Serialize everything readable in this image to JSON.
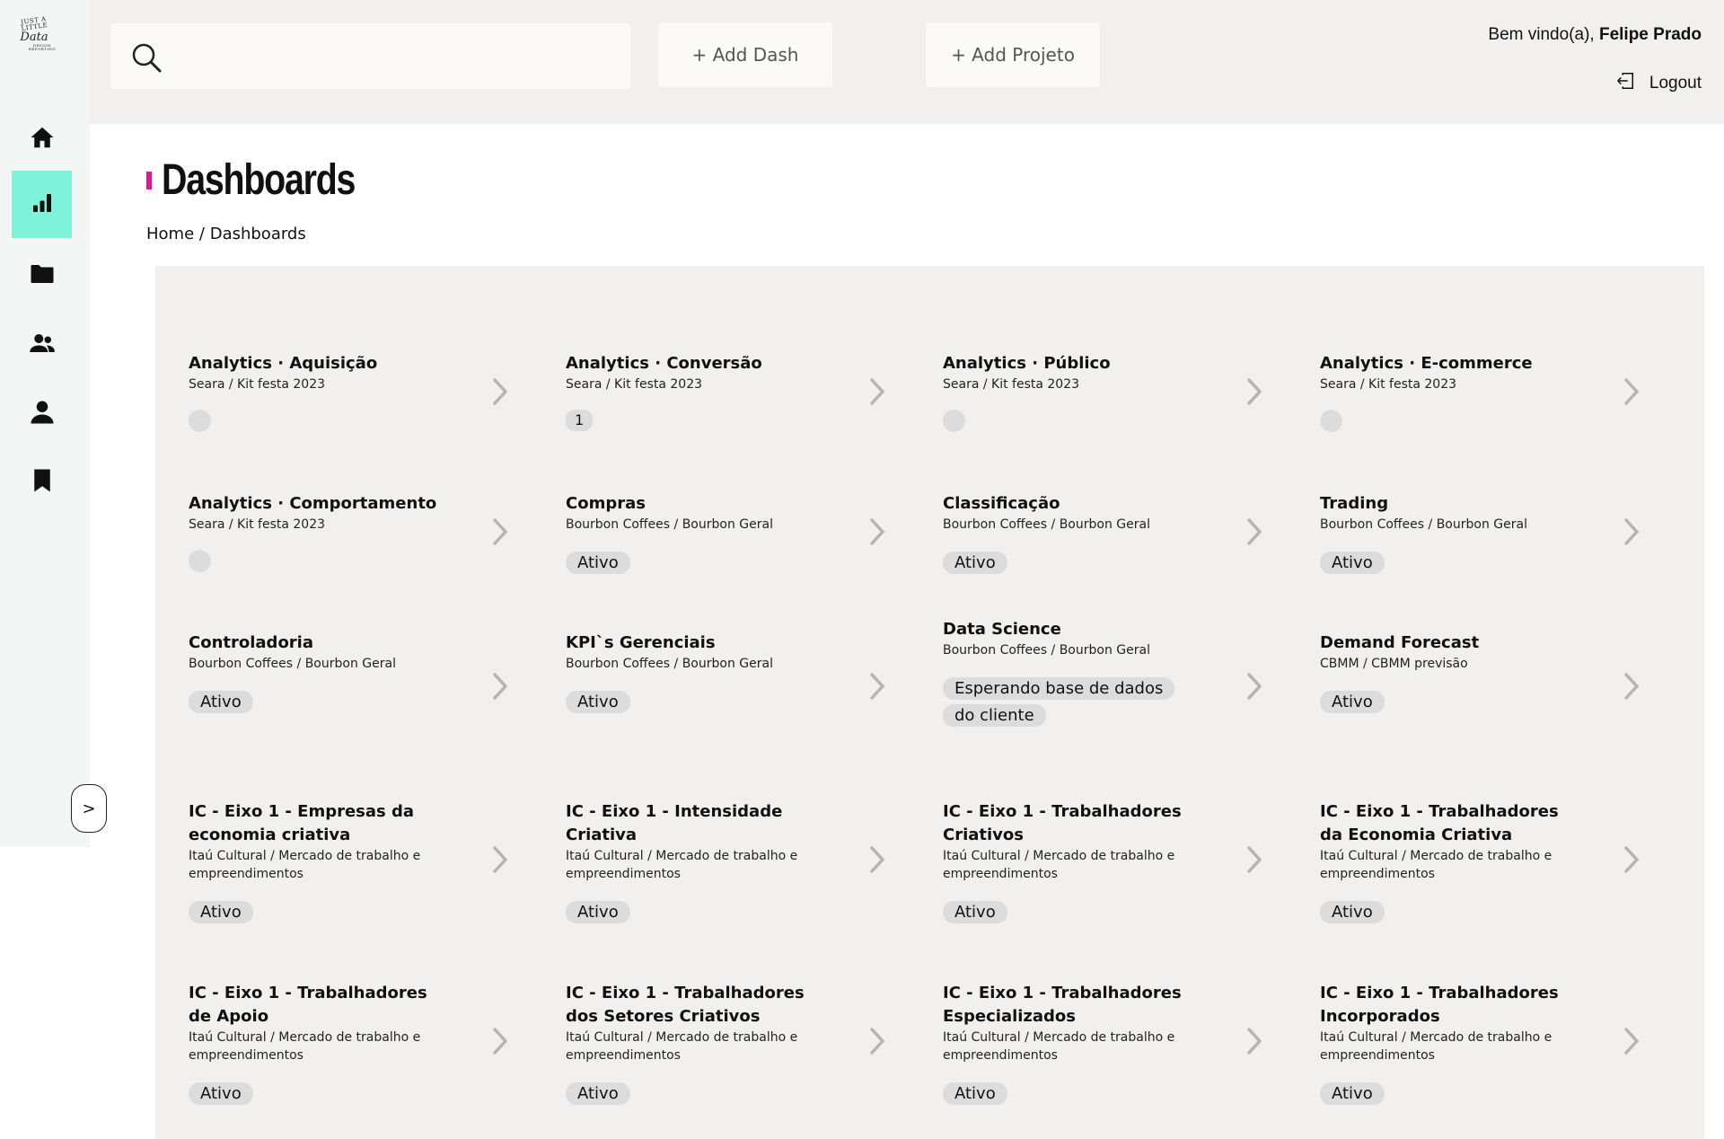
{
  "logo": {
    "line1": "JUST A LITTLE",
    "line2": "Data",
    "line3": "DESIGN REPORTING"
  },
  "sidebar": {
    "items": [
      {
        "name": "home-icon",
        "label": "Home"
      },
      {
        "name": "chart-icon",
        "label": "Dashboards",
        "active": true
      },
      {
        "name": "folder-icon",
        "label": "Projetos"
      },
      {
        "name": "group-icon",
        "label": "Clientes"
      },
      {
        "name": "user-icon",
        "label": "Usuários"
      },
      {
        "name": "bookmark-icon",
        "label": "Favoritos"
      }
    ],
    "toggle_label": ">"
  },
  "topbar": {
    "search_placeholder": "",
    "add_dash_label": "+ Add Dash",
    "add_project_label": "+ Add Projeto",
    "welcome_prefix": "Bem vindo(a), ",
    "user_name": "Felipe Prado",
    "logout_label": "Logout"
  },
  "page": {
    "title": "Dashboards",
    "breadcrumb_home": "Home",
    "breadcrumb_sep": "/",
    "breadcrumb_current": "Dashboards"
  },
  "colors": {
    "accent_active": "#7ff3da",
    "title_marker": "#e6158f",
    "panel_bg": "#f1f0ee",
    "badge_bg": "#dcdcdc"
  },
  "dashboards": [
    {
      "title": "Analytics · Aquisição",
      "subtitle": "Seara / Kit festa 2023",
      "status": ""
    },
    {
      "title": "Analytics · Conversão",
      "subtitle": "Seara / Kit festa 2023",
      "status": "1"
    },
    {
      "title": "Analytics · Público",
      "subtitle": "Seara / Kit festa 2023",
      "status": ""
    },
    {
      "title": "Analytics · E-commerce",
      "subtitle": "Seara / Kit festa 2023",
      "status": ""
    },
    {
      "title": "Analytics · Comportamento",
      "subtitle": "Seara / Kit festa 2023",
      "status": ""
    },
    {
      "title": "Compras",
      "subtitle": "Bourbon Coffees / Bourbon Geral",
      "status": "Ativo"
    },
    {
      "title": "Classificação",
      "subtitle": "Bourbon Coffees / Bourbon Geral",
      "status": "Ativo"
    },
    {
      "title": "Trading",
      "subtitle": "Bourbon Coffees / Bourbon Geral",
      "status": "Ativo"
    },
    {
      "title": "Controladoria",
      "subtitle": "Bourbon Coffees / Bourbon Geral",
      "status": "Ativo"
    },
    {
      "title": "KPI`s Gerenciais",
      "subtitle": "Bourbon Coffees / Bourbon Geral",
      "status": "Ativo"
    },
    {
      "title": "Data Science",
      "subtitle": "Bourbon Coffees / Bourbon Geral",
      "status": "Esperando base de dados do cliente"
    },
    {
      "title": "Demand Forecast",
      "subtitle": "CBMM / CBMM previsão",
      "status": "Ativo"
    },
    {
      "title": "IC - Eixo 1 - Empresas da economia criativa",
      "subtitle": "Itaú Cultural / Mercado de trabalho e empreendimentos",
      "status": "Ativo"
    },
    {
      "title": "IC - Eixo 1 - Intensidade Criativa",
      "subtitle": "Itaú Cultural / Mercado de trabalho e empreendimentos",
      "status": "Ativo"
    },
    {
      "title": "IC - Eixo 1 - Trabalhadores Criativos",
      "subtitle": "Itaú Cultural / Mercado de trabalho e empreendimentos",
      "status": "Ativo"
    },
    {
      "title": "IC - Eixo 1 - Trabalhadores da Economia Criativa",
      "subtitle": "Itaú Cultural / Mercado de trabalho e empreendimentos",
      "status": "Ativo"
    },
    {
      "title": "IC - Eixo 1 - Trabalhadores de Apoio",
      "subtitle": "Itaú Cultural / Mercado de trabalho e empreendimentos",
      "status": "Ativo"
    },
    {
      "title": "IC - Eixo 1 - Trabalhadores dos Setores Criativos",
      "subtitle": "Itaú Cultural / Mercado de trabalho e empreendimentos",
      "status": "Ativo"
    },
    {
      "title": "IC - Eixo 1 - Trabalhadores Especializados",
      "subtitle": "Itaú Cultural / Mercado de trabalho e empreendimentos",
      "status": "Ativo"
    },
    {
      "title": "IC - Eixo 1 - Trabalhadores Incorporados",
      "subtitle": "Itaú Cultural / Mercado de trabalho e empreendimentos",
      "status": "Ativo"
    }
  ]
}
